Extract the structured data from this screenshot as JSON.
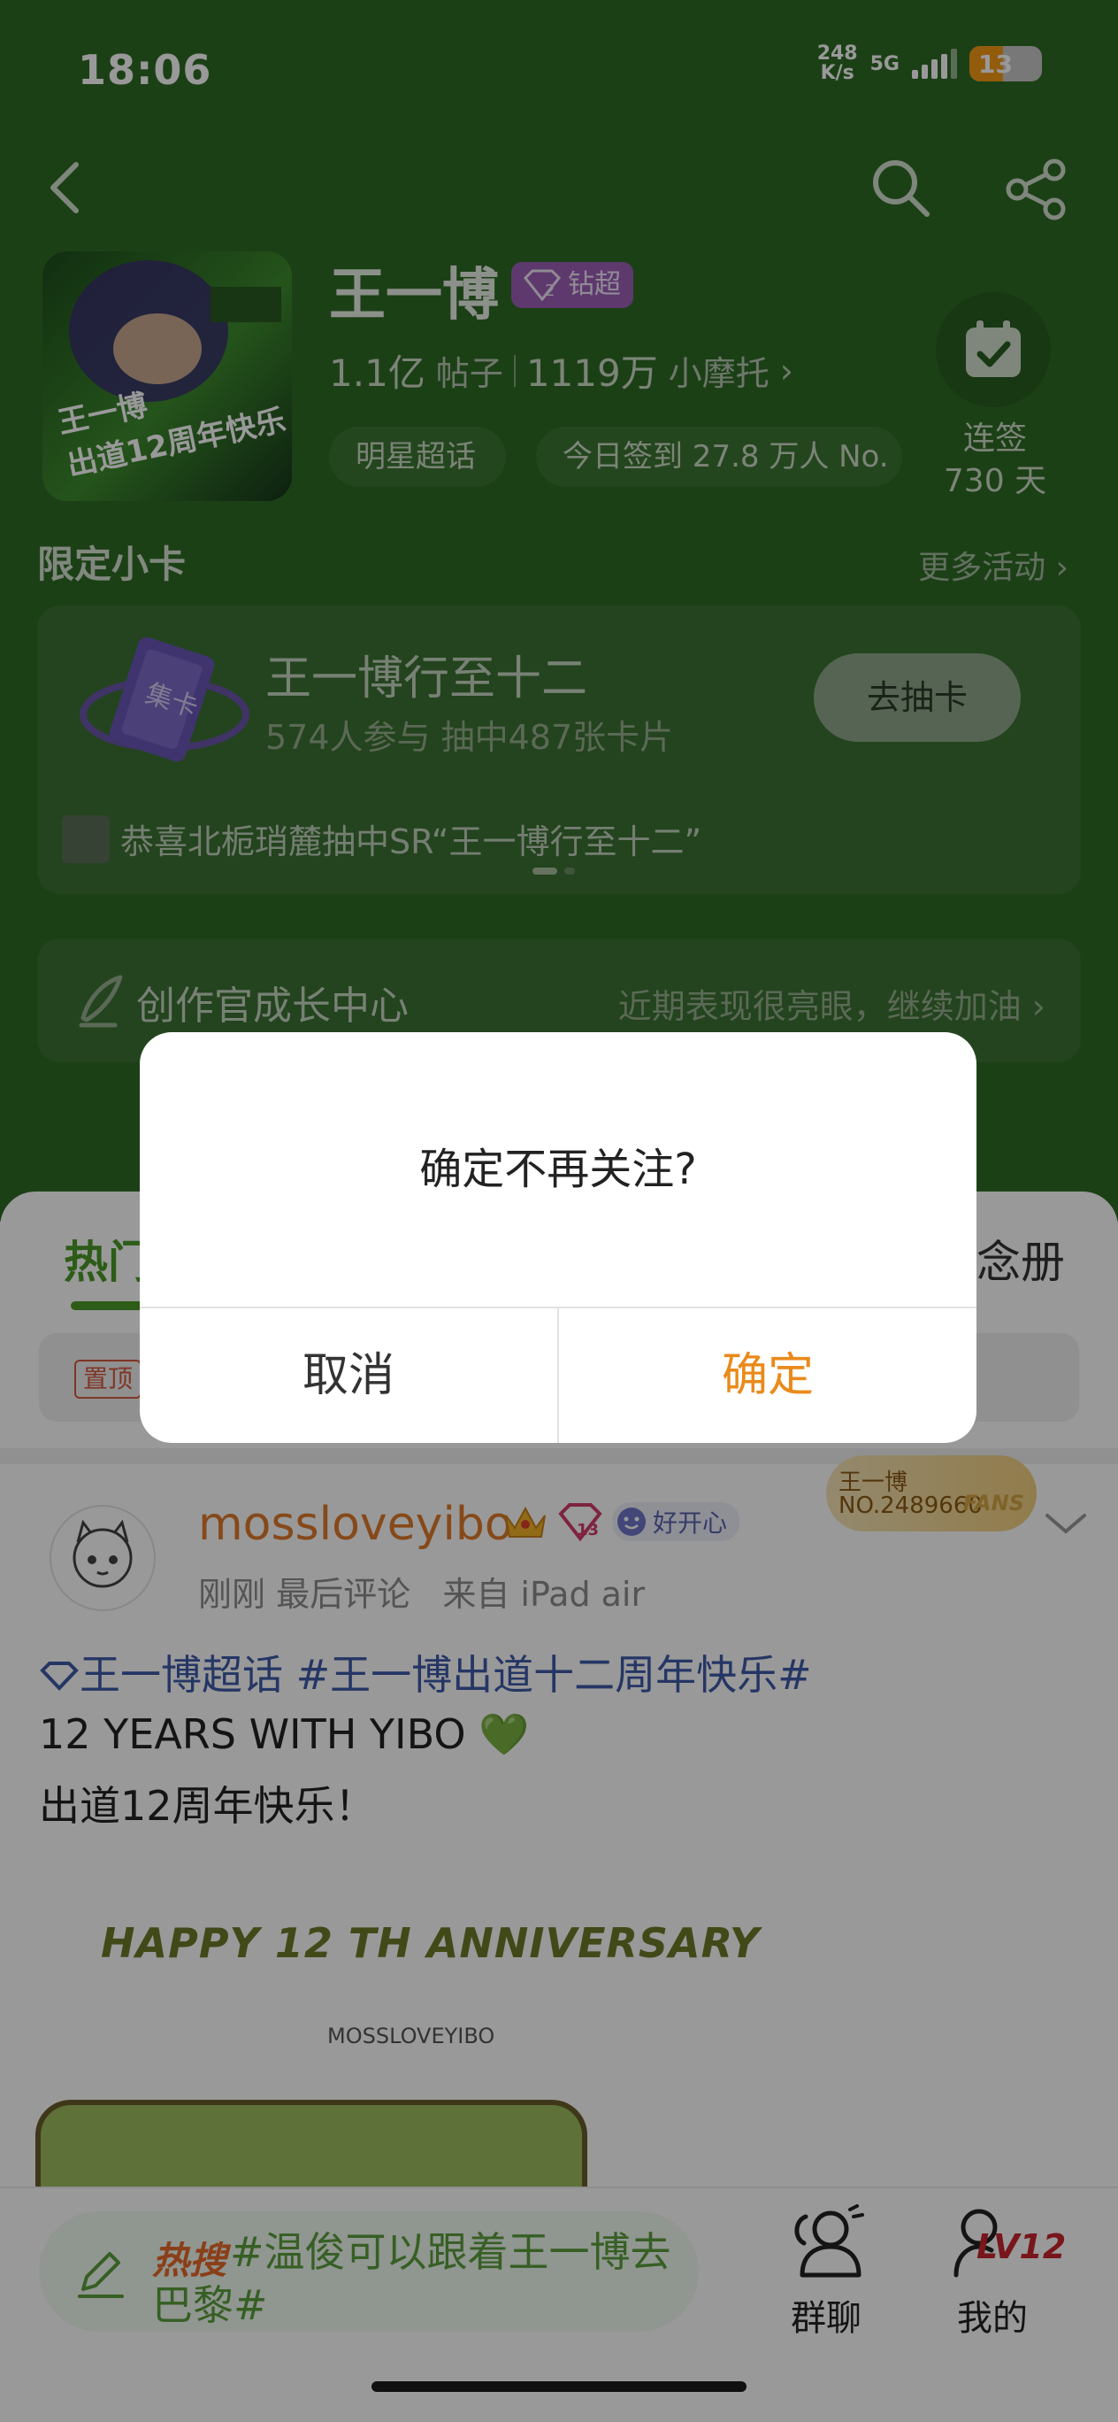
{
  "status_bar": {
    "time": "18:06",
    "net_speed_top": "248",
    "net_speed_bottom": "K/s",
    "net_type": "5G",
    "battery": "13"
  },
  "header": {
    "back_icon": "chevron-left-icon",
    "search_icon": "search-icon",
    "share_icon": "share-icon",
    "avatar_text_line1": "王一博",
    "avatar_text_line2": "出道12周年快乐",
    "title": "王一博",
    "level_badge": "钻超",
    "level_badge_number": "2",
    "posts_count": "1.1亿",
    "posts_label": "帖子",
    "fans_count": "1119万",
    "fans_label": "小摩托",
    "tag_star": "明星超话",
    "tag_checkin": "今日签到 27.8 万人 No.",
    "checkin_label": "连签",
    "checkin_days": "730 天"
  },
  "limited_cards": {
    "title": "限定小卡",
    "more": "更多活动",
    "card_title": "王一博行至十二",
    "card_sub": "574人参与 抽中487张卡片",
    "draw_button": "去抽卡",
    "card_icon_text": "集卡",
    "news": "恭喜北栀琑麓抽中SR“王一博行至十二”"
  },
  "growth": {
    "title": "创作官成长中心",
    "subtitle": "近期表现很亮眼，继续加油"
  },
  "tabs": {
    "hot": "热门",
    "right": "念册"
  },
  "pinned": {
    "tag": "置顶"
  },
  "post": {
    "username": "mossloveyibo",
    "vip_level": "13",
    "good_badge": "好开心",
    "meta": "刚刚 最后评论   来自 iPad air",
    "fans_badge_name": "王一博",
    "fans_badge_no": "NO.2489660",
    "fans_badge_fans": "FANS",
    "line1": "王一博超话 #王一博出道十二周年快乐#",
    "line2": "12 YEARS WITH YIBO 💚",
    "line3": "出道12周年快乐！",
    "image_text": "HAPPY 12 TH ANNIVERSARY",
    "image_sub": "MOSSLOVEYIBO"
  },
  "bottom": {
    "hot_label": "热搜",
    "hot_text": "#温俊可以跟着王一博去巴黎#",
    "group_chat": "群聊",
    "mine": "我的",
    "level": "LV12"
  },
  "dialog": {
    "message": "确定不再关注?",
    "cancel": "取消",
    "confirm": "确定"
  },
  "colors": {
    "header_green": "#2f6b25",
    "accent_orange": "#ea8a1a",
    "hot_green": "#4a9a28"
  }
}
